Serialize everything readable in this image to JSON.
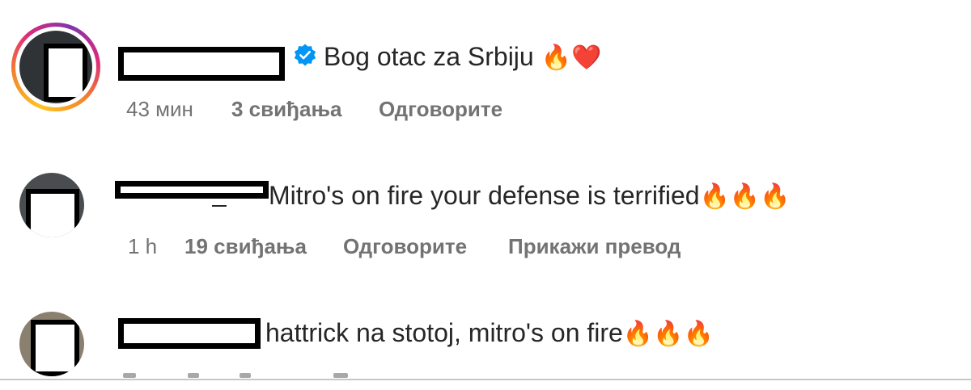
{
  "comments": [
    {
      "text": "Bog otac za Srbiju ",
      "emojis": "🔥❤️",
      "verified": true,
      "time": "43 мин",
      "likes": "3 свиђања",
      "reply": "Одговорите"
    },
    {
      "text": "Mitro's on fire your defense is terrified",
      "emojis": "🔥🔥🔥",
      "time": "1 h",
      "likes": "19 свиђања",
      "reply": "Одговорите",
      "translate": "Прикажи превод"
    },
    {
      "text": "hattrick na stotoj, mitro's on fire",
      "emojis": "🔥🔥🔥"
    }
  ],
  "colors": {
    "text": "#262626",
    "meta": "#737373",
    "verified": "#0095f6"
  },
  "icons": [
    "verified-badge-icon"
  ]
}
